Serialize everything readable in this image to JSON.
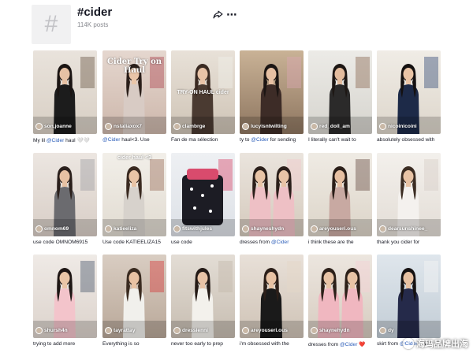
{
  "header": {
    "icon": "hashtag-icon",
    "hash_glyph": "#",
    "title": "#cider",
    "post_count": "114K posts"
  },
  "videos": [
    {
      "author": "son.joanne",
      "cap_pre": "My lil ",
      "mention": "@Cider",
      "cap_post": " haul 🤍🤍",
      "overlay": ""
    },
    {
      "author": "nstaliaxox7",
      "cap_pre": "",
      "mention": "@Cider",
      "cap_post": " haul<3. Use",
      "overlay": "Cider Try on Haul"
    },
    {
      "author": "clambrge",
      "cap_pre": "Fan de ma sélection",
      "mention": "",
      "cap_post": "",
      "overlay": "TRY-ON HAUL cider"
    },
    {
      "author": "lucyisntwilting",
      "cap_pre": "ty to ",
      "mention": "@Cider",
      "cap_post": " for sending",
      "overlay": ""
    },
    {
      "author": "red_doll_am",
      "cap_pre": "I literally can't wait to",
      "mention": "",
      "cap_post": "",
      "overlay": ""
    },
    {
      "author": "nicoinicoini",
      "cap_pre": "absolutely obsessed with",
      "mention": "",
      "cap_post": "",
      "overlay": ""
    },
    {
      "author": "omnom69",
      "cap_pre": "use code OMNOM6915",
      "mention": "",
      "cap_post": "",
      "overlay": ""
    },
    {
      "author": "katieeliza",
      "cap_pre": "Use code KATIEELIZA15",
      "mention": "",
      "cap_post": "",
      "overlay": "cider haul <3"
    },
    {
      "author": "fitswithjules",
      "cap_pre": "use code",
      "mention": "",
      "cap_post": "",
      "overlay": ""
    },
    {
      "author": "shayneshydn",
      "cap_pre": "dresses from ",
      "mention": "@Cider",
      "cap_post": "",
      "overlay": ""
    },
    {
      "author": "areyouseri.ous",
      "cap_pre": "i think these are the",
      "mention": "",
      "cap_post": "",
      "overlay": ""
    },
    {
      "author": "dearsunshinee_",
      "cap_pre": "thank you cider for",
      "mention": "",
      "cap_post": "",
      "overlay": ""
    },
    {
      "author": "shursh4n",
      "cap_pre": "trying to add more",
      "mention": "",
      "cap_post": "",
      "overlay": ""
    },
    {
      "author": "tayrattay",
      "cap_pre": "Everything is so",
      "mention": "",
      "cap_post": "",
      "overlay": ""
    },
    {
      "author": "dressienni",
      "cap_pre": "never too early to prep",
      "mention": "",
      "cap_post": "",
      "overlay": ""
    },
    {
      "author": "areyouseri.ous",
      "cap_pre": "i'm obsessed with the",
      "mention": "",
      "cap_post": "",
      "overlay": ""
    },
    {
      "author": "shaynehydn",
      "cap_pre": "dresses from ",
      "mention": "@Cider",
      "cap_post": " ❤️",
      "overlay": ""
    },
    {
      "author": "dy",
      "cap_pre": "skirt from ",
      "mention": "@Cider",
      "cap_post": " use",
      "overlay": ""
    }
  ],
  "watermark": {
    "text": "海玛品牌出海"
  }
}
